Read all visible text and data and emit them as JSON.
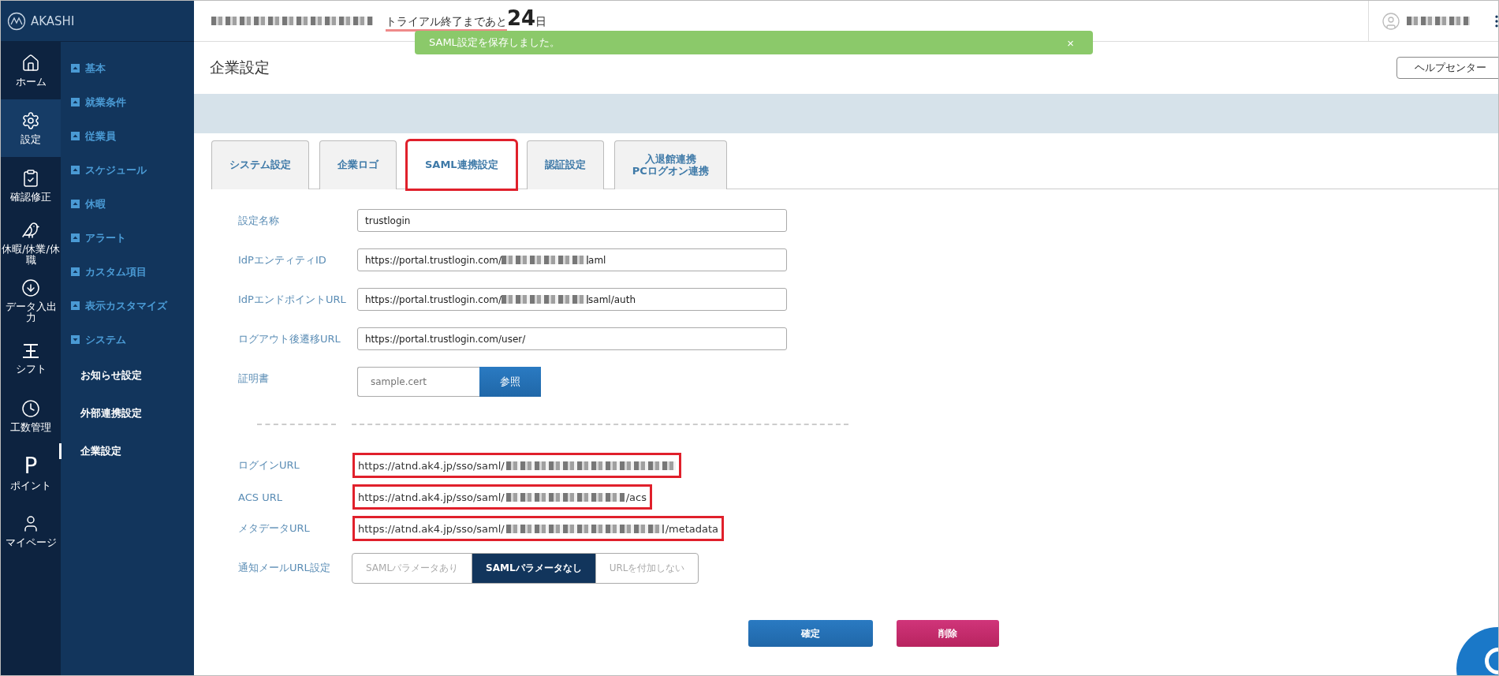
{
  "brand": {
    "name": "AKASHI"
  },
  "header": {
    "trial_text": "トライアル終了まであと",
    "trial_days": "24",
    "trial_unit": "日"
  },
  "toast": {
    "message": "SAML設定を保存しました。",
    "close": "×"
  },
  "rail": [
    {
      "label": "ホーム",
      "selected": false
    },
    {
      "label": "設定",
      "selected": true
    },
    {
      "label": "確認修正",
      "selected": false
    },
    {
      "label": "休暇/休業/休職",
      "selected": false
    },
    {
      "label": "データ入出力",
      "selected": false
    },
    {
      "label": "シフト",
      "selected": false
    },
    {
      "label": "工数管理",
      "selected": false
    },
    {
      "label": "ポイント",
      "selected": false,
      "glyph": "P"
    },
    {
      "label": "マイページ",
      "selected": false
    }
  ],
  "menu": [
    {
      "label": "基本",
      "expanded": false
    },
    {
      "label": "就業条件",
      "expanded": false
    },
    {
      "label": "従業員",
      "expanded": false
    },
    {
      "label": "スケジュール",
      "expanded": false
    },
    {
      "label": "休暇",
      "expanded": false
    },
    {
      "label": "アラート",
      "expanded": false
    },
    {
      "label": "カスタム項目",
      "expanded": false
    },
    {
      "label": "表示カスタマイズ",
      "expanded": false
    },
    {
      "label": "システム",
      "expanded": true,
      "children": [
        {
          "label": "お知らせ設定",
          "selected": false
        },
        {
          "label": "外部連携設定",
          "selected": false
        },
        {
          "label": "企業設定",
          "selected": true
        }
      ]
    }
  ],
  "page": {
    "title": "企業設定",
    "help_button": "ヘルプセンター"
  },
  "tabs": [
    {
      "label": "システム設定",
      "selected": false,
      "highlighted": false
    },
    {
      "label": "企業ロゴ",
      "selected": false,
      "highlighted": false
    },
    {
      "label": "SAML連携設定",
      "selected": true,
      "highlighted": true
    },
    {
      "label": "認証設定",
      "selected": false,
      "highlighted": false
    },
    {
      "label": "入退館連携\nPCログオン連携",
      "selected": false,
      "highlighted": false
    }
  ],
  "fields": [
    {
      "label": "設定名称",
      "value": "trustlogin"
    },
    {
      "label": "IdPエンティティID",
      "value": "https://portal.trustlogin.com/",
      "suffix": "aml"
    },
    {
      "label": "IdPエンドポイントURL",
      "value": "https://portal.trustlogin.com/",
      "suffix": "saml/auth"
    },
    {
      "label": "ログアウト後遷移URL",
      "value": "https://portal.trustlogin.com/user/"
    }
  ],
  "certificate": {
    "label": "証明書",
    "placeholder": "sample.cert",
    "button": "参照"
  },
  "urls": [
    {
      "label": "ログインURL",
      "value": "https://atnd.ak4.jp/sso/saml/",
      "highlighted": true
    },
    {
      "label": "ACS URL",
      "value": "https://atnd.ak4.jp/sso/saml/",
      "suffix": "/acs",
      "highlighted": true
    },
    {
      "label": "メタデータURL",
      "value": "https://atnd.ak4.jp/sso/saml/",
      "suffix": "/metadata",
      "highlighted": true
    }
  ],
  "mail_url": {
    "label": "通知メールURL設定",
    "options": [
      {
        "label": "SAMLパラメータあり",
        "selected": false
      },
      {
        "label": "SAMLパラメータなし",
        "selected": true
      },
      {
        "label": "URLを付加しない",
        "selected": false
      }
    ]
  },
  "actions": {
    "confirm": "確定",
    "delete": "削除"
  }
}
